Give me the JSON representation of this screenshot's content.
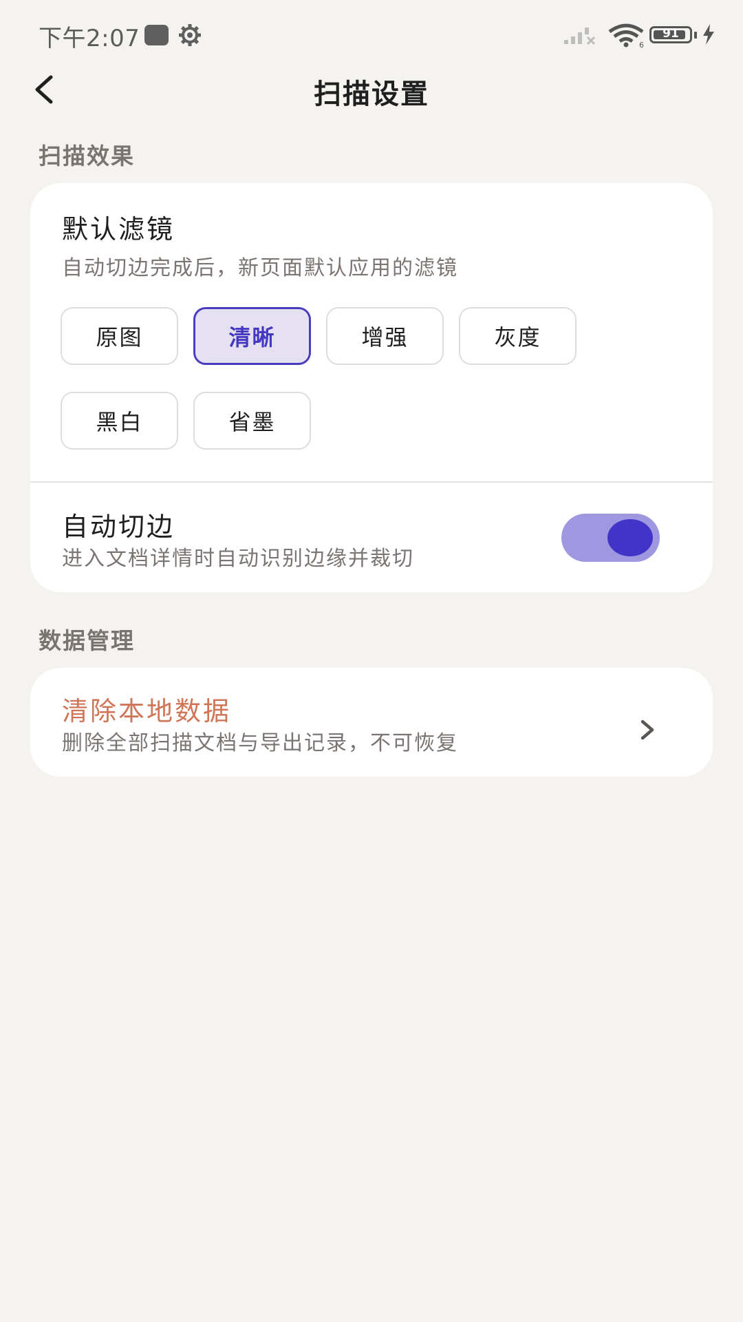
{
  "status_bar": {
    "time": "下午2:07",
    "battery": "91",
    "battery_level": 0.91,
    "network_label": "6",
    "icons": [
      "app-icon",
      "gear-icon",
      "signal-icon",
      "wifi-icon",
      "battery-icon",
      "charging-icon"
    ]
  },
  "header": {
    "title": "扫描设置",
    "back_icon": "chevron-left-icon"
  },
  "sections": {
    "scan_effect": {
      "label": "扫描效果",
      "filter": {
        "title": "默认滤镜",
        "description": "自动切边完成后，新页面默认应用的滤镜",
        "options": [
          "原图",
          "清晰",
          "增强",
          "灰度",
          "黑白",
          "省墨"
        ],
        "selected": "清晰"
      },
      "auto_crop": {
        "title": "自动切边",
        "description": "进入文档详情时自动识别边缘并裁切",
        "enabled": true
      }
    },
    "data_management": {
      "label": "数据管理",
      "clear_data": {
        "title": "清除本地数据",
        "description": "删除全部扫描文档与导出记录，不可恢复",
        "icon": "chevron-right-icon"
      }
    }
  },
  "colors": {
    "background": "#f4f3f0",
    "accent": "#4334c8",
    "accent_light": "#9f97e0",
    "chip_selected_bg": "#e5e1f3",
    "danger": "#d07658"
  }
}
